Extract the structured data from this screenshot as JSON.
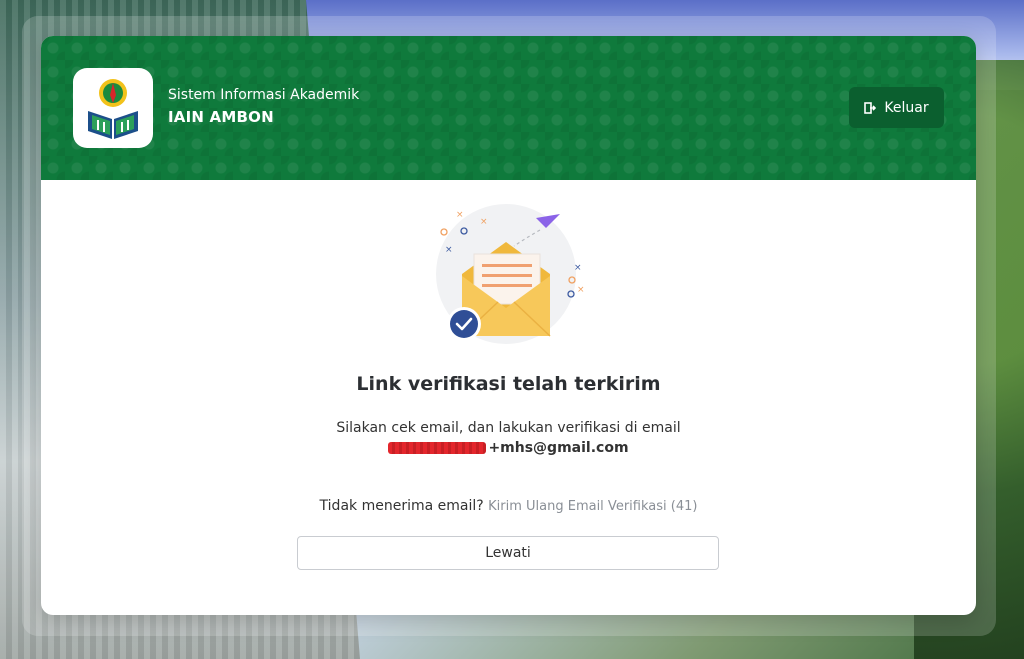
{
  "app": {
    "subtitle": "Sistem Informasi Akademik",
    "title": "IAIN AMBON"
  },
  "header": {
    "logout_label": "Keluar"
  },
  "verification": {
    "heading": "Link verifikasi telah terkirim",
    "message": "Silakan cek email, dan lakukan verifikasi di email",
    "email_visible": "+mhs@gmail.com",
    "resend_prompt": "Tidak menerima email?",
    "resend_link": "Kirim Ulang Email Verifikasi (41)",
    "skip_label": "Lewati"
  },
  "icons": {
    "logout": "logout-icon",
    "email_illustration": "envelope-sent-illustration",
    "check": "check-icon"
  },
  "colors": {
    "header_green": "#0f7a3c",
    "button_dark_green": "#0b5f2f",
    "envelope": "#f7c24b",
    "badge_blue": "#2f4e96",
    "plane": "#8b63e8"
  }
}
